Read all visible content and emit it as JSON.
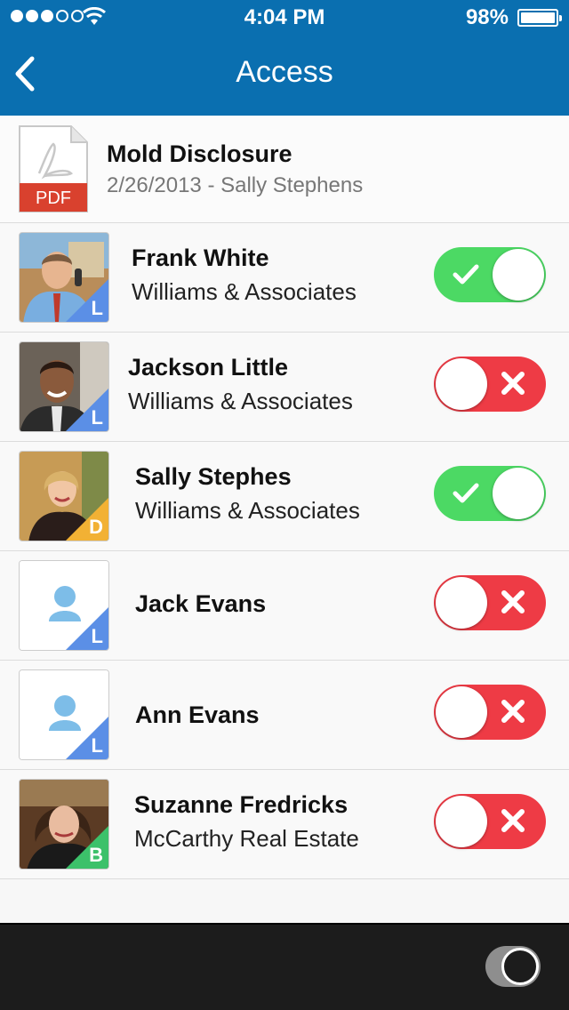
{
  "status_bar": {
    "time": "4:04 PM",
    "battery": "98%",
    "signal_bars_filled": 3,
    "signal_bars_total": 5
  },
  "nav": {
    "title": "Access",
    "back_icon": "chevron-left-icon"
  },
  "document": {
    "icon": "pdf-icon",
    "icon_label": "PDF",
    "title": "Mold Disclosure",
    "subtitle": "2/26/2013 - Sally Stephens"
  },
  "people": [
    {
      "name": "Frank White",
      "company": "Williams & Associates",
      "role_badge": "L",
      "badge_color": "#5b8fe6",
      "access": true,
      "avatar": "photo"
    },
    {
      "name": "Jackson Little",
      "company": "Williams & Associates",
      "role_badge": "L",
      "badge_color": "#5b8fe6",
      "access": false,
      "avatar": "photo"
    },
    {
      "name": "Sally Stephes",
      "company": "Williams & Associates",
      "role_badge": "D",
      "badge_color": "#f2b134",
      "access": true,
      "avatar": "photo"
    },
    {
      "name": "Jack Evans",
      "company": "",
      "role_badge": "L",
      "badge_color": "#5b8fe6",
      "access": false,
      "avatar": "placeholder"
    },
    {
      "name": "Ann Evans",
      "company": "",
      "role_badge": "L",
      "badge_color": "#5b8fe6",
      "access": false,
      "avatar": "placeholder"
    },
    {
      "name": "Suzanne Fredricks",
      "company": "McCarthy Real Estate",
      "role_badge": "B",
      "badge_color": "#3cc16a",
      "access": false,
      "avatar": "photo"
    }
  ],
  "colors": {
    "nav_bg": "#0a6fb0",
    "toggle_on": "#4cd964",
    "toggle_off": "#ee3b45",
    "bottom_bar": "#1c1c1c"
  },
  "bottom_bar": {
    "toggle_icon": "toggle-switch-icon"
  }
}
